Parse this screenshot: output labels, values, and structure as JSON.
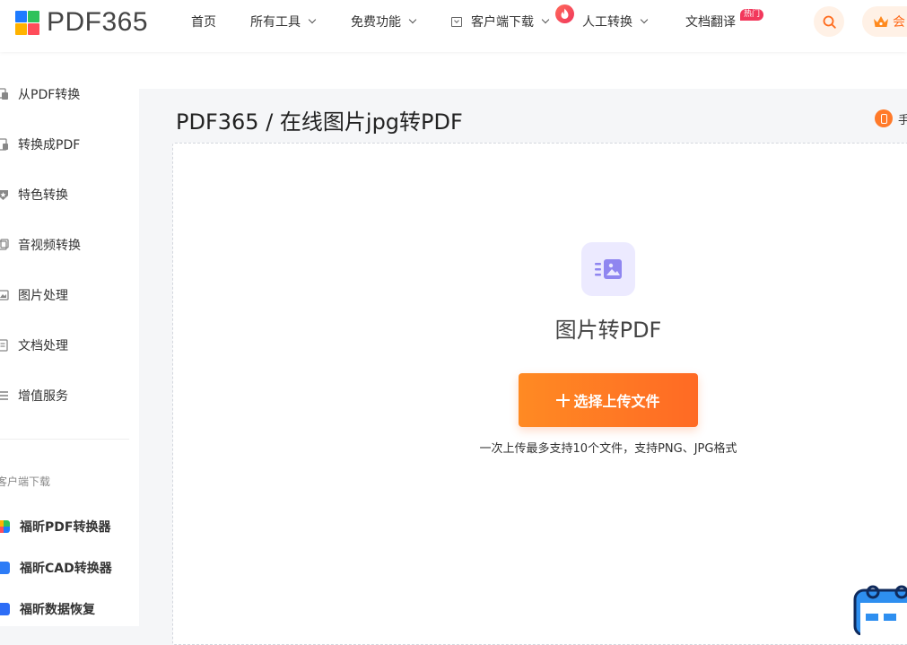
{
  "brand": {
    "logo_text": "PDF365",
    "logo_colors": [
      "#1e7bff",
      "#2fc25b",
      "#ffb300",
      "#ff4d5a"
    ]
  },
  "nav": {
    "home": "首页",
    "all_tools": "所有工具",
    "free_features": "免费功能",
    "client_download": "客户端下载",
    "human_convert": "人工转换",
    "doc_translate": "文档翻译",
    "hot_badge": "热门",
    "vip_label": "会"
  },
  "sidebar": {
    "items": [
      {
        "label": "从PDF转换",
        "icon": "doc-from-icon"
      },
      {
        "label": "转换成PDF",
        "icon": "doc-to-icon"
      },
      {
        "label": "特色转换",
        "icon": "star-shield-icon"
      },
      {
        "label": "音视频转换",
        "icon": "media-icon"
      },
      {
        "label": "图片处理",
        "icon": "image-icon"
      },
      {
        "label": "文档处理",
        "icon": "doc-process-icon"
      },
      {
        "label": "增值服务",
        "icon": "list-icon"
      }
    ],
    "section_title": "客户端下载",
    "apps": [
      {
        "label": "福昕PDF转换器",
        "icon": "foxit-pdf-icon",
        "color": "#33b36a"
      },
      {
        "label": "福昕CAD转换器",
        "icon": "foxit-cad-icon",
        "color": "#2d7cf6"
      },
      {
        "label": "福昕数据恢复",
        "icon": "foxit-recovery-icon",
        "color": "#2d6df6"
      }
    ]
  },
  "main": {
    "breadcrumb": "PDF365 / 在线图片jpg转PDF",
    "phone_link": "手",
    "tool_title": "图片转PDF",
    "upload_button": "选择上传文件",
    "upload_hint": "一次上传最多支持10个文件，支持PNG、JPG格式"
  },
  "colors": {
    "accent": "#ff7a24",
    "tool_icon_bg": "#eceaff",
    "tool_icon_fg": "#8f86f0",
    "hot": "#f2385c"
  }
}
